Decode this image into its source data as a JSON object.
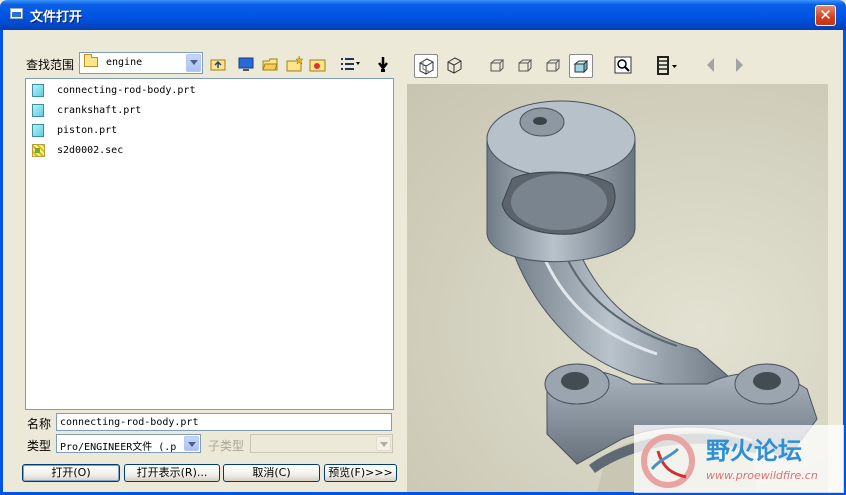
{
  "window": {
    "title": "文件打开",
    "close_glyph": "✕"
  },
  "lookin": {
    "label": "查找范围",
    "value": "engine"
  },
  "files": [
    {
      "name": "connecting-rod-body.prt",
      "icon": "part-icon"
    },
    {
      "name": "crankshaft.prt",
      "icon": "part-icon"
    },
    {
      "name": "piston.prt",
      "icon": "part-icon"
    },
    {
      "name": "s2d0002.sec",
      "icon": "section-icon"
    }
  ],
  "name_field": {
    "label": "名称",
    "value": "connecting-rod-body.prt"
  },
  "type_field": {
    "label": "类型",
    "value": "Pro/ENGINEER文件 (.p",
    "subtype_label": "子类型"
  },
  "buttons": {
    "open": "打开(O)",
    "open_rep": "打开表示(R)...",
    "cancel": "取消(C)",
    "preview": "预览(F)>>>"
  },
  "watermark": {
    "brand": "野火论坛",
    "url": "www.proewildfire.cn"
  },
  "colors": {
    "titlebar": "#0054e3",
    "close": "#d4411c",
    "model": "#8f9ca8"
  }
}
